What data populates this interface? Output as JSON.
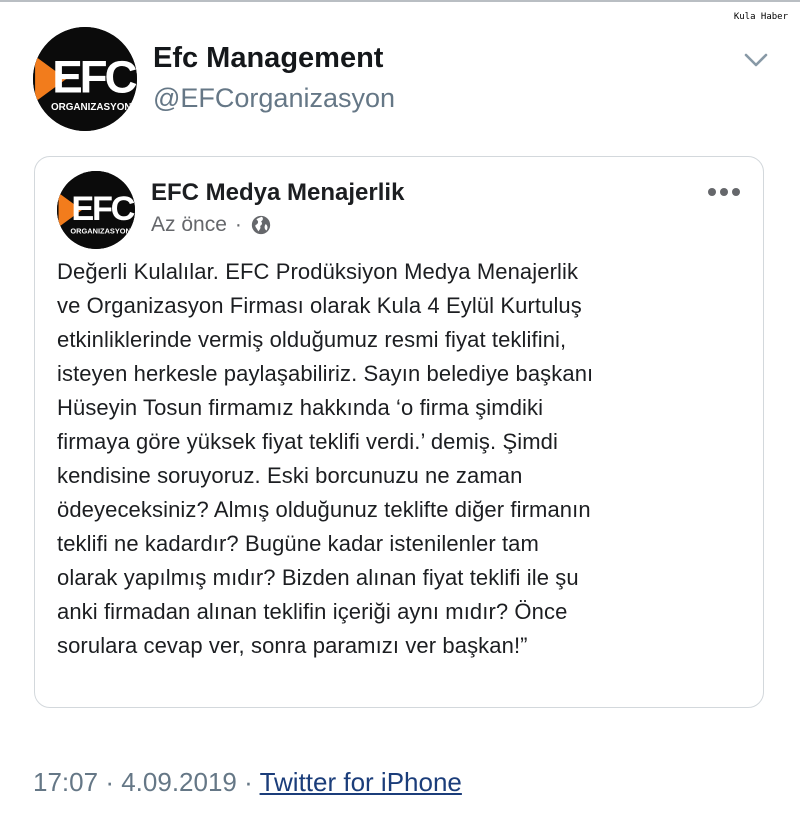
{
  "watermark": "Kula Haber",
  "tweet": {
    "author_name": "Efc Management",
    "author_handle": "@EFCorganizasyon",
    "avatar_icon": "efc-organizasyon-logo",
    "menu_icon": "chevron-down-icon",
    "timestamp": "17:07",
    "separator": "·",
    "date": "4.09.2019",
    "source": "Twitter for iPhone"
  },
  "embedded_post": {
    "page_name": "EFC Medya Menajerlik",
    "time": "Az önce",
    "separator": "·",
    "privacy_icon": "globe-icon",
    "more_icon": "more-dots-icon",
    "lines": [
      "Değerli Kulalılar.  EFC Prodüksiyon Medya Menajerlik",
      "ve Organizasyon Firması olarak Kula 4 Eylül Kurtuluş",
      "etkinliklerinde vermiş olduğumuz resmi fiyat teklifini,",
      "isteyen herkesle paylaşabiliriz. Sayın belediye başkanı",
      "Hüseyin Tosun firmamız hakkında ‘o firma şimdiki",
      "firmaya göre yüksek fiyat teklifi verdi.’ demiş.  Şimdi",
      "kendisine soruyoruz.  Eski borcunuzu ne zaman",
      "ödeyeceksiniz? Almış olduğunuz teklifte diğer firmanın",
      "teklifi ne kadardır? Bugüne kadar istenilenler tam",
      "olarak yapılmış mıdır? Bizden alınan fiyat teklifi ile şu",
      "anki firmadan alınan teklifin içeriği aynı mıdır? Önce",
      "sorulara cevap ver, sonra paramızı ver başkan!”"
    ]
  },
  "logo": {
    "letters": "EFC",
    "caption": "ORGANIZASYON"
  },
  "colors": {
    "logo_orange": "#f27c1c",
    "logo_black": "#0b0b0b",
    "link": "#1b3d7a",
    "muted": "#657786"
  }
}
